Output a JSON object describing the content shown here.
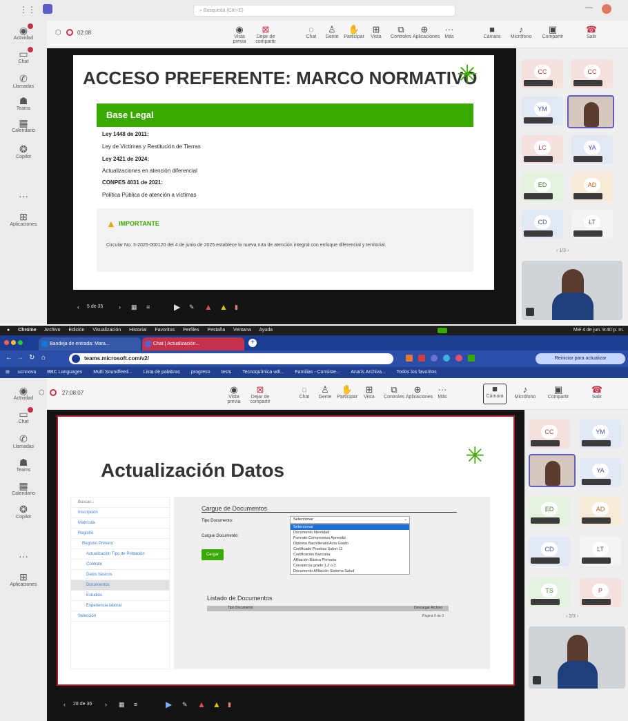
{
  "top": {
    "search_placeholder": "Búsqueda (Ctrl+E)",
    "timer": "02:08",
    "rail": [
      "Actividad",
      "Chat",
      "Llamadas",
      "Teams",
      "Calendario",
      "Copilot",
      "Aplicaciones"
    ],
    "toolbar": [
      "Vista previa",
      "Dejar de compartir",
      "Chat",
      "Gente",
      "Participar",
      "Vista",
      "Controles",
      "Aplicaciones",
      "Más",
      "Cámara",
      "Micrófono",
      "Compartir",
      "Salir"
    ],
    "slide": {
      "title": "ACCESO PREFERENTE: MARCO NORMATIVO",
      "section": "Base Legal",
      "law1": "Ley 1448 de 2011:",
      "law1_desc": "Ley de Víctimas y Restitución de Tierras",
      "law2": "Ley 2421 de 2024:",
      "law2_desc": "Actualizaciones en atención diferencial",
      "law3": "CONPES 4031 de 2021:",
      "law3_desc": "Política Pública de atención a víctimas",
      "important": "IMPORTANTE",
      "note": "Circular No. 3-2025-000120 del 4 de junio de 2025 establece la nueva ruta de atención integral con enfoque diferencial y territorial."
    },
    "page": "5 de 35",
    "participants": [
      "CC",
      "CC",
      "YM",
      "",
      "LC",
      "YA",
      "ED",
      "AD",
      "CD",
      "LT"
    ],
    "pager": "1/3"
  },
  "mac": {
    "menu": [
      "Chrome",
      "Archivo",
      "Edición",
      "Visualización",
      "Historial",
      "Favoritos",
      "Perfiles",
      "Pestaña",
      "Ventana",
      "Ayuda"
    ],
    "clock": "Mié 4 de jun. 9:40 p. m."
  },
  "browser": {
    "tab1": "Bandeja de entrada: Mara...",
    "tab2": "Chat | Actualización...",
    "url": "teams.microsoft.com/v2/",
    "update": "Reiniciar para actualizar",
    "bookmarks": [
      "ucnnova",
      "BBC Languages",
      "Multi Soundfeed...",
      "Lista de palabras",
      "progreso",
      "tests",
      "Tecnoquímica udl...",
      "Familias - Consiste...",
      "Anaris Archiva...",
      "Todos los favoritos"
    ]
  },
  "bottom": {
    "timer": "27:08:07",
    "slide_title": "Actualización Datos",
    "menu": [
      "Inscripción",
      "Matrícula",
      "Registro",
      "Registro Primero",
      "Actualización Tipo de Población",
      "Contrato",
      "Datos básicos",
      "Documentos",
      "Estudios",
      "Experiencia laboral",
      "Selección"
    ],
    "search_label": "Buscar...",
    "cargue_title": "Cargue de Documentos",
    "tipo_label": "Tipo Documento:",
    "cargue_label": "Cargue Documento:",
    "select_value": "Seleccionar",
    "options": [
      "Seleccionar",
      "Documento Identidad",
      "Formato Compromiso Aprendiz",
      "Diploma Bachillerato/Acta Grado",
      "Certificado Pruebas Saber 11",
      "Certificación Bancaria",
      "Afiliación Básica Primaria",
      "Constancia grado 1,2 o 3",
      "Documento Afiliación Sistema Salud"
    ],
    "cargar_btn": "Cargar",
    "listado_title": "Listado de Documentos",
    "col1": "Tipo Documento",
    "col2": "Descargar Archivo",
    "pagination": "Página 0 de 0",
    "page": "28 de 36",
    "participants": [
      "CC",
      "YM",
      "",
      "YA",
      "ED",
      "AD",
      "CD",
      "LT",
      "TS",
      "P"
    ],
    "pager": "2/3"
  },
  "colors": {
    "sena_green": "#39a900",
    "teams_purple": "#5b5fc7",
    "stage": "#141414"
  }
}
